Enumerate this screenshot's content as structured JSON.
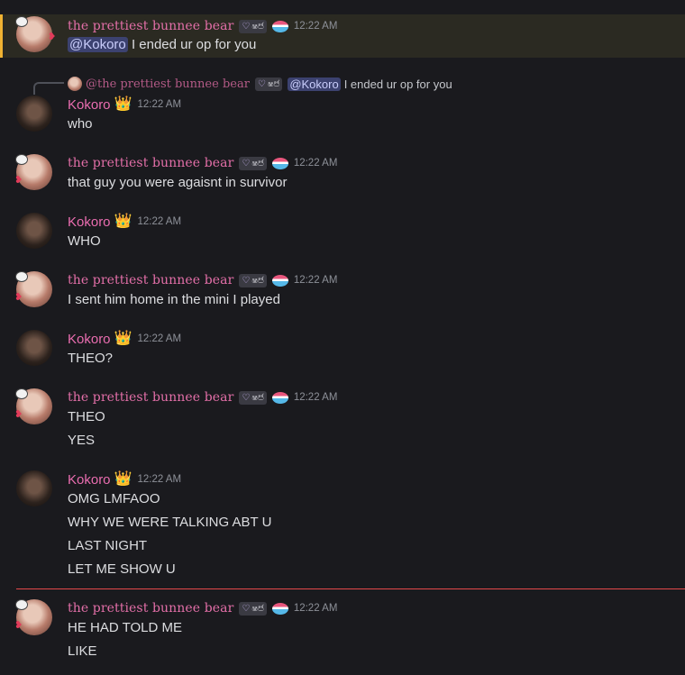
{
  "users": {
    "bear": {
      "name": "the prettiest bunnee bear",
      "tag_heart": "♡",
      "tag_text": "ෂ෪",
      "time": "12:22 AM"
    },
    "koko": {
      "name": "Kokoro",
      "crown": "👑",
      "time": "12:22 AM"
    }
  },
  "messages": [
    {
      "mention": "@Kokoro",
      "text": "I ended ur op for you"
    },
    {
      "reply": {
        "name": "@the prettiest bunnee bear",
        "mention": "@Kokoro",
        "text": "I ended ur op for you"
      },
      "lines": [
        "who"
      ]
    },
    {
      "lines": [
        "that guy you were agaisnt in survivor"
      ]
    },
    {
      "lines": [
        "WHO"
      ]
    },
    {
      "lines": [
        "I sent him home in the mini I played"
      ]
    },
    {
      "lines": [
        "THEO?"
      ]
    },
    {
      "lines": [
        "THEO",
        "YES"
      ]
    },
    {
      "lines": [
        "OMG LMFAOO",
        "WHY WE WERE TALKING ABT U",
        "LAST NIGHT",
        "LET ME SHOW U"
      ]
    },
    {
      "lines": [
        "HE HAD TOLD ME",
        "LIKE"
      ]
    }
  ],
  "colors": {
    "background": "#1a1a1e",
    "highlight_bar": "#f0b232",
    "name_pink": "#e36fa8",
    "new_divider": "#e3494b"
  }
}
